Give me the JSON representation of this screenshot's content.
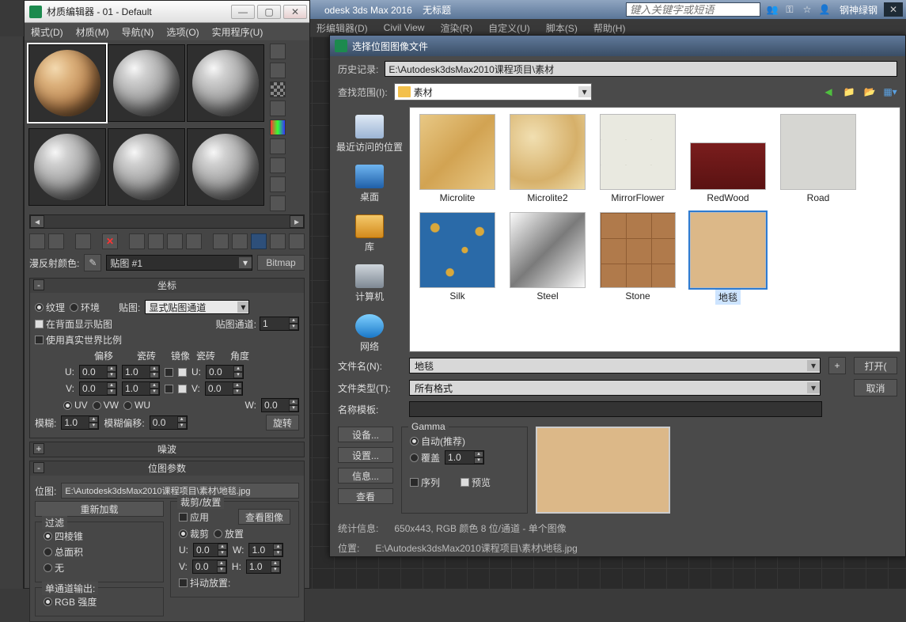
{
  "app": {
    "title_partial": "odesk 3ds Max 2016",
    "doc_title": "无标题",
    "search_placeholder": "键入关键字或短语",
    "user": "钢神绿钢"
  },
  "main_menu": [
    "形编辑器(D)",
    "Civil View",
    "渲染(R)",
    "自定义(U)",
    "脚本(S)",
    "帮助(H)"
  ],
  "mat_editor": {
    "title": "材质编辑器 - 01 - Default",
    "menu": [
      "模式(D)",
      "材质(M)",
      "导航(N)",
      "选项(O)",
      "实用程序(U)"
    ],
    "diffuse_label": "漫反射颜色:",
    "map_name": "贴图 #1",
    "map_type": "Bitmap",
    "panels": {
      "coords": {
        "title": "坐标",
        "texture": "纹理",
        "environ": "环境",
        "mapping_label": "贴图:",
        "mapping_value": "显式贴图通道",
        "show_back": "在背面显示贴图",
        "map_channel_label": "贴图通道:",
        "map_channel": "1",
        "use_real": "使用真实世界比例",
        "hdr_offset": "偏移",
        "hdr_tiling": "瓷砖",
        "hdr_mirror": "镜像",
        "hdr_tile": "瓷砖",
        "hdr_angle": "角度",
        "u": "U:",
        "v": "V:",
        "w": "W:",
        "u_off": "0.0",
        "u_tile": "1.0",
        "u_ang": "0.0",
        "v_off": "0.0",
        "v_tile": "1.0",
        "v_ang": "0.0",
        "w_ang": "0.0",
        "uv": "UV",
        "vw": "VW",
        "wu": "WU",
        "blur_label": "模糊:",
        "blur": "1.0",
        "blur_off_label": "模糊偏移:",
        "blur_off": "0.0",
        "rotate": "旋转"
      },
      "noise": "噪波",
      "bitmap_params": {
        "title": "位图参数",
        "bitmap_label": "位图:",
        "bitmap_path": "E:\\Autodesk3dsMax2010课程项目\\素材\\地毯.jpg",
        "reload": "重新加载",
        "crop_title": "裁剪/放置",
        "apply": "应用",
        "view_image": "查看图像",
        "crop": "裁剪",
        "place": "放置",
        "filter_title": "过滤",
        "pyramidal": "四棱锥",
        "sat": "总面积",
        "none": "无",
        "u": "U:",
        "v": "V:",
        "w": "W:",
        "h": "H:",
        "u_v": "0.0",
        "v_v": "0.0",
        "w_v": "1.0",
        "h_v": "1.0",
        "jitter": "抖动放置:",
        "mono_title": "单通道输出:",
        "rgb_intensity": "RGB 强度"
      }
    }
  },
  "file_dialog": {
    "title": "选择位图图像文件",
    "history_label": "历史记录:",
    "history_value": "E:\\Autodesk3dsMax2010课程项目\\素材",
    "lookin_label": "查找范围(I):",
    "lookin_value": "素材",
    "places": {
      "recent": "最近访问的位置",
      "desktop": "桌面",
      "lib": "库",
      "computer": "计算机",
      "network": "网络"
    },
    "files": [
      {
        "name": "Microlite",
        "cls": "th-microlite"
      },
      {
        "name": "Microlite2",
        "cls": "th-microlite2"
      },
      {
        "name": "MirrorFlower",
        "cls": "th-mirror"
      },
      {
        "name": "RedWood",
        "cls": "th-redwood"
      },
      {
        "name": "Road",
        "cls": "th-road"
      },
      {
        "name": "Silk",
        "cls": "th-silk"
      },
      {
        "name": "Steel",
        "cls": "th-steel"
      },
      {
        "name": "Stone",
        "cls": "th-stone"
      },
      {
        "name": "地毯",
        "cls": "th-carpet",
        "sel": true
      }
    ],
    "filename_label": "文件名(N):",
    "filename_value": "地毯",
    "filetype_label": "文件类型(T):",
    "filetype_value": "所有格式",
    "template_label": "名称模板:",
    "open_btn": "打开(",
    "cancel_btn": "取消",
    "side_btns": {
      "device": "设备...",
      "setup": "设置...",
      "info": "信息...",
      "view": "查看"
    },
    "gamma": {
      "title": "Gamma",
      "auto": "自动(推荐)",
      "override": "覆盖",
      "value": "1.0"
    },
    "sequence": "序列",
    "preview": "预览",
    "stats_label": "统计信息:",
    "stats_value": "650x443, RGB 颜色 8 位/通道 - 单个图像",
    "loc_label": "位置:",
    "loc_value": "E:\\Autodesk3dsMax2010课程项目\\素材\\地毯.jpg"
  }
}
